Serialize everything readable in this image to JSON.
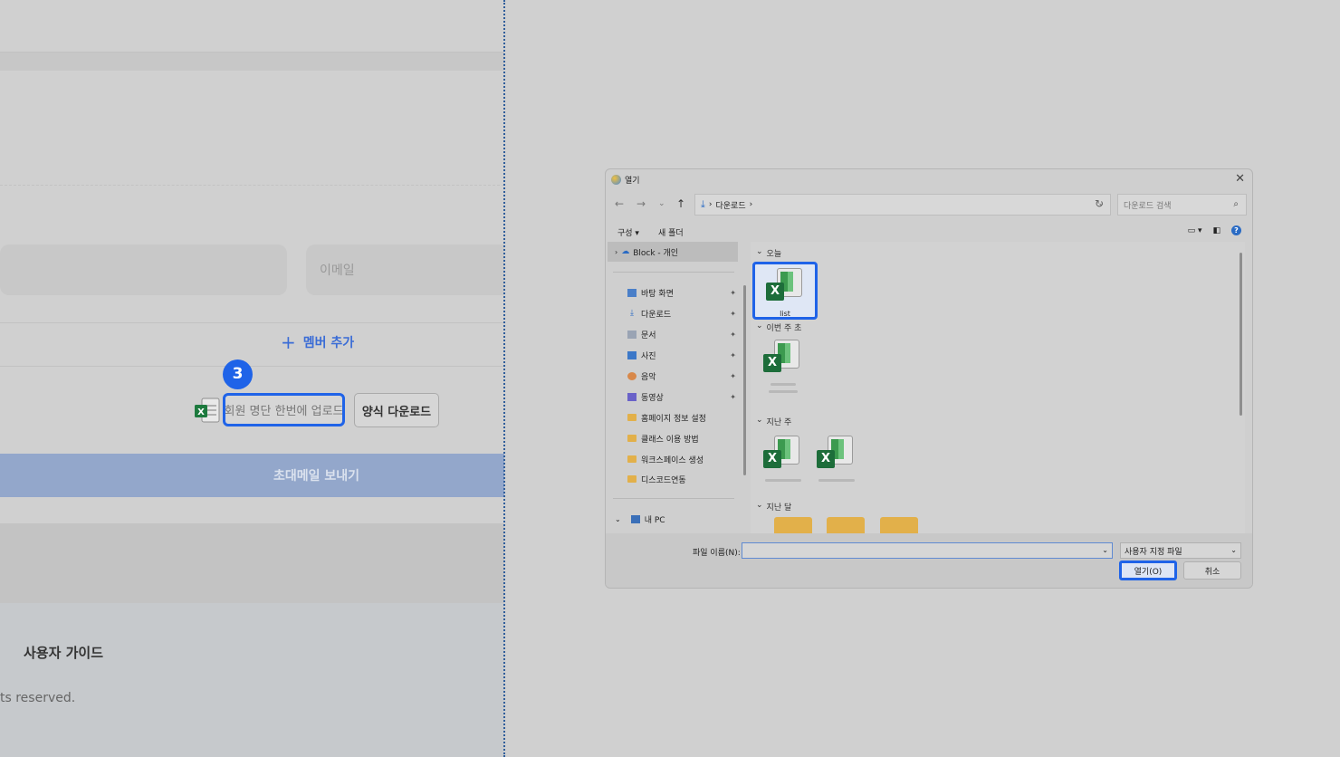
{
  "left_panel": {
    "email_field_placeholder": "이메일",
    "add_member_label": "멤버 추가",
    "step_badge": "3",
    "upload_button_label": "회원 명단 한번에 업로드",
    "template_download_label": "양식 다운로드",
    "send_invite_label": "초대메일 보내기",
    "footer_guide": "사용자 가이드",
    "footer_rights": "ts reserved."
  },
  "dialog": {
    "title": "열기",
    "close_glyph": "✕",
    "address_path": [
      "다운로드"
    ],
    "search_placeholder": "다운로드 검색",
    "toolbar": {
      "organize": "구성 ▾",
      "new_folder": "새 폴더"
    },
    "sidebar": {
      "onedrive": "Block - 개인",
      "quick_access": [
        {
          "label": "바탕 화면",
          "icon": "desktop-icon",
          "pinned": true
        },
        {
          "label": "다운로드",
          "icon": "download-icon",
          "pinned": true
        },
        {
          "label": "문서",
          "icon": "document-icon",
          "pinned": true
        },
        {
          "label": "사진",
          "icon": "picture-icon",
          "pinned": true
        },
        {
          "label": "음악",
          "icon": "music-icon",
          "pinned": true
        },
        {
          "label": "동영상",
          "icon": "video-icon",
          "pinned": true
        },
        {
          "label": "홈페이지 정보 설정",
          "icon": "folder-icon",
          "pinned": false
        },
        {
          "label": "클래스 이용 방법",
          "icon": "folder-icon",
          "pinned": false
        },
        {
          "label": "워크스페이스 생성",
          "icon": "folder-icon",
          "pinned": false
        },
        {
          "label": "디스코드연동",
          "icon": "folder-icon",
          "pinned": false
        }
      ],
      "this_pc": "내 PC"
    },
    "groups": {
      "today": "오늘",
      "this_week": "이번 주 초",
      "last_week": "지난 주",
      "last_month": "지난 달"
    },
    "selected_file": "list",
    "filename_label": "파일 이름(N):",
    "filename_value": "",
    "filetype": "사용자 지정 파일",
    "open_button": "열기(O)",
    "cancel_button": "취소"
  }
}
